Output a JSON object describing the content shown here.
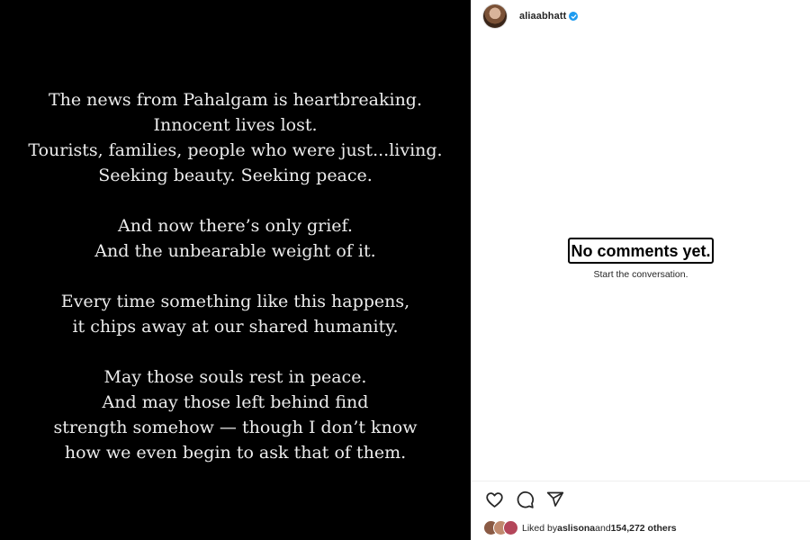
{
  "post": {
    "stanzas": [
      [
        "The news from Pahalgam is heartbreaking.",
        "Innocent lives lost.",
        "Tourists, families, people who were just...living.",
        "Seeking beauty. Seeking peace."
      ],
      [
        "And now there’s only grief.",
        "And the unbearable weight of it."
      ],
      [
        "Every time something like this happens,",
        "it chips away at our shared humanity."
      ],
      [
        "May those souls rest in peace.",
        "And may those left behind find",
        "strength somehow — though I don’t know",
        "how we even begin to ask that of them."
      ]
    ]
  },
  "header": {
    "avatar_icon": "profile-avatar",
    "username": "aliaabhatt",
    "verified_icon": "verified-badge-icon"
  },
  "comments": {
    "empty_title": "No comments yet.",
    "empty_subtitle": "Start the conversation."
  },
  "actions": {
    "icons": [
      "heart-icon",
      "comment-icon",
      "share-icon"
    ]
  },
  "likes": {
    "prefix": "Liked by ",
    "user": "aslisona",
    "middle": " and ",
    "count": "154,272 others"
  },
  "colors": {
    "post_background": "#000000",
    "post_text": "#ececec",
    "verified": "#1d9bf0",
    "panel_background": "#ffffff"
  }
}
